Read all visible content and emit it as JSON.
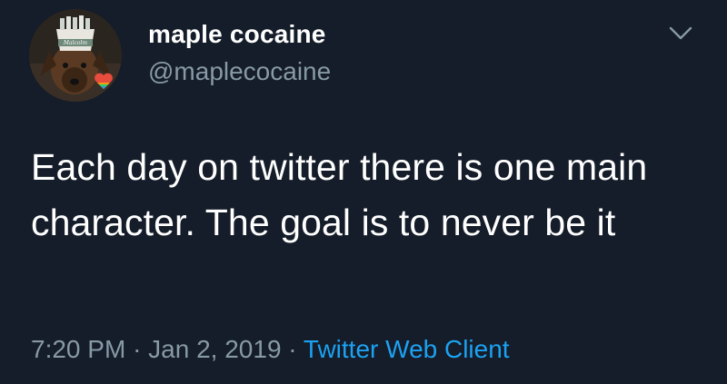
{
  "tweet": {
    "author": {
      "display_name": "maple cocaine",
      "handle": "@maplecocaine",
      "avatar_icon": "dog-avatar-with-pride-heart",
      "avatar_hat_text": "Malcolm"
    },
    "body": "Each day on twitter there is one main character. The goal is to never be it",
    "meta": {
      "time": "7:20 PM",
      "separator": "·",
      "date": "Jan 2, 2019",
      "source": "Twitter Web Client"
    },
    "menu_icon": "chevron-down-icon"
  },
  "colors": {
    "background": "#141d29",
    "primary_text": "#ffffff",
    "secondary_text": "#8899a6",
    "accent": "#1da1f2"
  }
}
